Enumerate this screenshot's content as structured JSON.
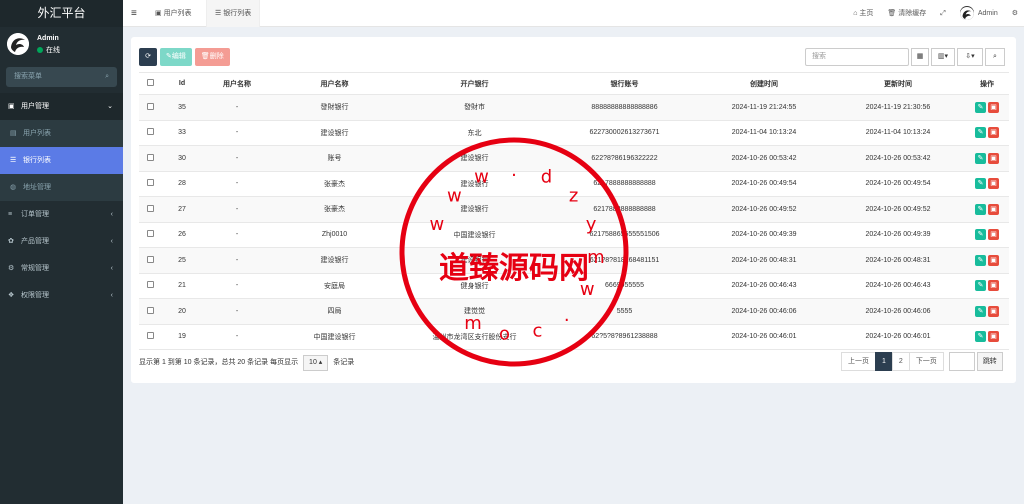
{
  "sidebar": {
    "brand": "外汇平台",
    "user": {
      "name": "Admin",
      "status": "在线"
    },
    "search_placeholder": "搜索菜单",
    "menu": [
      {
        "label": "用户管理",
        "icon": "user-icon",
        "open": true
      },
      {
        "label": "用户列表",
        "icon": "list-icon",
        "sub": true
      },
      {
        "label": "银行列表",
        "icon": "database-icon",
        "sub": true,
        "active": true
      },
      {
        "label": "地址管理",
        "icon": "globe-icon",
        "sub": true
      },
      {
        "label": "订单管理",
        "icon": "list-icon"
      },
      {
        "label": "产品管理",
        "icon": "gear-icon"
      },
      {
        "label": "常规管理",
        "icon": "cogs-icon"
      },
      {
        "label": "权限管理",
        "icon": "group-icon"
      }
    ]
  },
  "header": {
    "tabs": [
      "用户列表",
      "银行列表"
    ],
    "home": "主页",
    "clear_cache": "清除缓存",
    "admin": "Admin"
  },
  "toolbar": {
    "edit": "编辑",
    "delete": "删除",
    "search_placeholder": "搜索"
  },
  "table": {
    "columns": [
      "Id",
      "用户名称",
      "用户名称",
      "开户银行",
      "银行账号",
      "创建时间",
      "更新时间",
      "操作"
    ],
    "rows": [
      [
        "35",
        "-",
        "發財银行",
        "發財市",
        "88888888888888886",
        "2024-11-19 21:24:55",
        "2024-11-19 21:30:56"
      ],
      [
        "33",
        "-",
        "建设银行",
        "东北",
        "6227300026132736​71",
        "2024-11-04 10:13:24",
        "2024-11-04 10:13:24"
      ],
      [
        "30",
        "-",
        "账号",
        "建设银行",
        "622?8?86196322222",
        "2024-10-26 00:53:42",
        "2024-10-26 00:53:42"
      ],
      [
        "28",
        "-",
        "张豪杰",
        "建设银行",
        "6217888888888888",
        "2024-10-26 00:49:54",
        "2024-10-26 00:49:54"
      ],
      [
        "27",
        "-",
        "张豪杰",
        "建设银行",
        "6217888888888888",
        "2024-10-26 00:49:52",
        "2024-10-26 00:49:52"
      ],
      [
        "26",
        "-",
        "Zhj0010",
        "中国建设银行",
        "621758865555551506",
        "2024-10-26 00:49:39",
        "2024-10-26 00:49:39"
      ],
      [
        "25",
        "-",
        "建设银行",
        "建设银行",
        "621?8?8181684811​51",
        "2024-10-26 00:48:31",
        "2024-10-26 00:48:31"
      ],
      [
        "21",
        "-",
        "安庭局",
        "健身银行",
        "6669955555",
        "2024-10-26 00:46:43",
        "2024-10-26 00:46:43"
      ],
      [
        "20",
        "-",
        "四局",
        "建觉觉",
        "5555",
        "2024-10-26 00:46:06",
        "2024-10-26 00:46:06"
      ],
      [
        "19",
        "-",
        "中国建设银行",
        "温州市龙湾区支行股份支行",
        "62?5?8?8961238888",
        "2024-10-26 00:46:01",
        "2024-10-26 00:46:01"
      ]
    ]
  },
  "footer": {
    "info_pre": "显示第 1 到第 10 条记录，总共 20 条记录 每页显示",
    "page_size": "10",
    "info_post": "条记录",
    "prev": "上一页",
    "pages": [
      "1",
      "2"
    ],
    "next": "下一页",
    "jump": "跳转"
  },
  "watermark": {
    "title": "道臻源码网",
    "url_chars": [
      "w",
      "w",
      "w",
      ".",
      "d",
      "z",
      "y",
      "m",
      "w",
      ".",
      "c",
      "o",
      "m"
    ]
  },
  "colors": {
    "sidebar": "#222d32",
    "active": "#5b7be6",
    "stamp": "#e60012"
  }
}
